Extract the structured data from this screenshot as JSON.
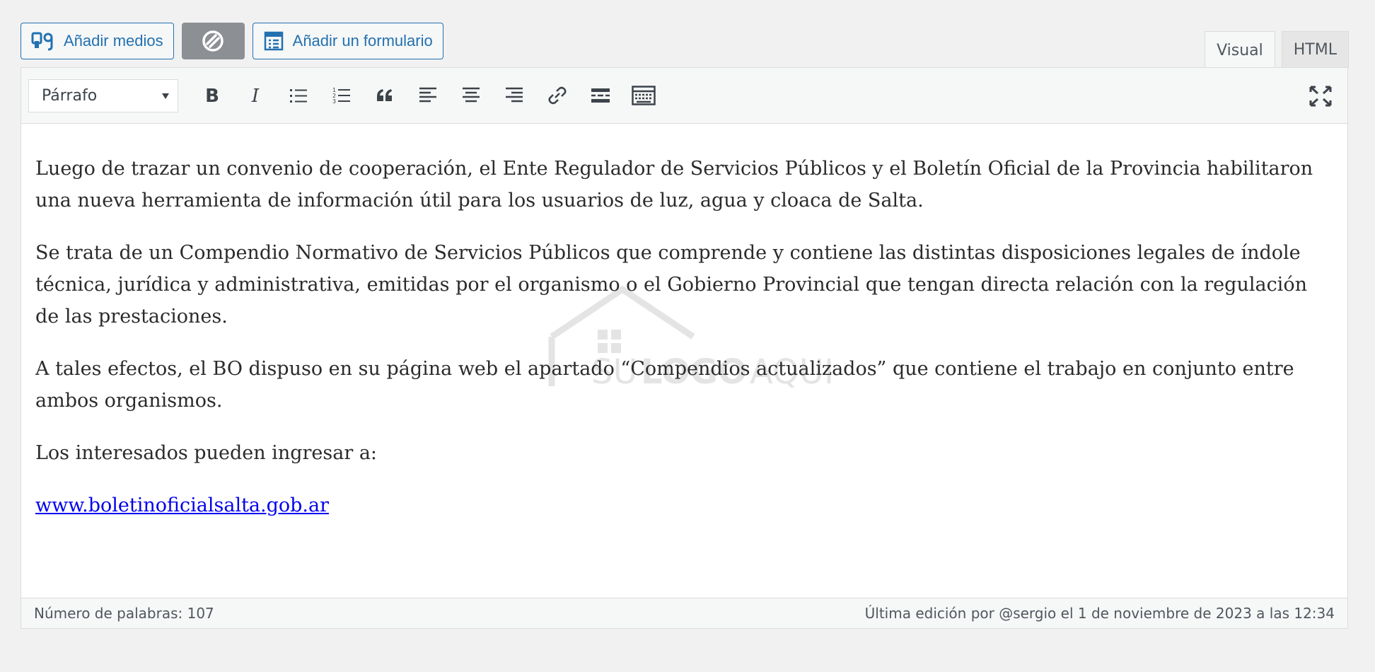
{
  "media_buttons": {
    "add_media": "Añadir medios",
    "add_form": "Añadir un formulario"
  },
  "tabs": {
    "visual": "Visual",
    "html": "HTML"
  },
  "toolbar": {
    "format_selected": "Párrafo",
    "icons": [
      "bold-icon",
      "italic-icon",
      "bulleted-list-icon",
      "numbered-list-icon",
      "blockquote-icon",
      "align-left-icon",
      "align-center-icon",
      "align-right-icon",
      "link-icon",
      "read-more-icon",
      "toolbar-toggle-icon"
    ]
  },
  "content": {
    "paragraphs": [
      "Luego de trazar un convenio de cooperación, el Ente Regulador de Servicios Públicos y el Boletín Oficial de la Provincia habilitaron una nueva herramienta de información útil para los usuarios de luz, agua y cloaca de Salta.",
      "Se trata de un Compendio Normativo de Servicios Públicos que comprende y contiene las distintas disposiciones legales de índole técnica, jurídica y administrativa, emitidas por el organismo o el Gobierno Provincial que tengan directa relación con la regulación de las prestaciones.",
      "A tales efectos, el BO dispuso en su página web el apartado “Compendios actualizados” que contiene el trabajo en conjunto entre ambos organismos.",
      "Los interesados pueden ingresar a:"
    ],
    "link_text": "www.boletinoficialsalta.gob.ar"
  },
  "watermark": {
    "text_su": "SU",
    "text_logo": "LOGO",
    "text_aqui": "AQUI"
  },
  "status": {
    "word_count": "Número de palabras: 107",
    "last_edit": "Última edición por @sergio el 1 de noviembre de 2023 a las 12:34"
  },
  "colors": {
    "accent": "#2271b1",
    "link": "#0000ee",
    "grey_button": "#8c8f94"
  }
}
